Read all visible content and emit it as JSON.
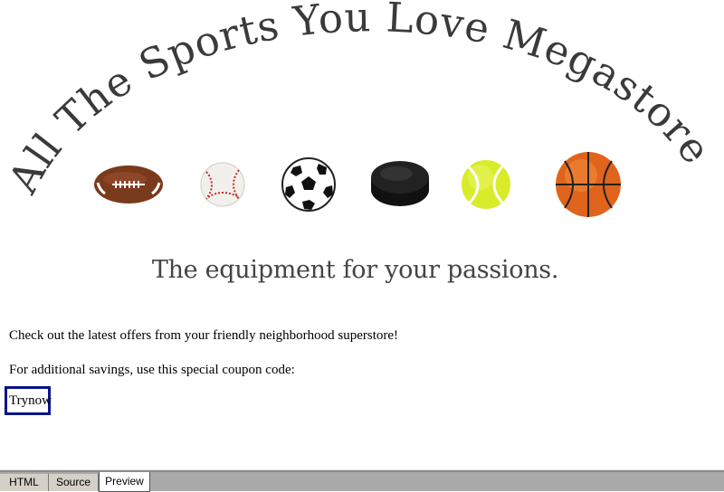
{
  "banner": {
    "title": "All The Sports You Love Megastore!",
    "balls": [
      "football-icon",
      "baseball-icon",
      "soccer-ball-icon",
      "hockey-puck-icon",
      "tennis-ball-icon",
      "basketball-icon"
    ]
  },
  "tagline": "The equipment for your passions.",
  "content": {
    "offers_text": "Check out the latest offers from your friendly neighborhood superstore!",
    "coupon_intro": "For additional savings, use this special coupon code:",
    "coupon_code": "Trynow"
  },
  "tabs": {
    "html": "HTML",
    "source": "Source",
    "preview": "Preview",
    "active": "Preview"
  },
  "colors": {
    "title": "#3a3a3a",
    "coupon_border": "#0a128c",
    "tabbar": "#a9a9a9"
  }
}
